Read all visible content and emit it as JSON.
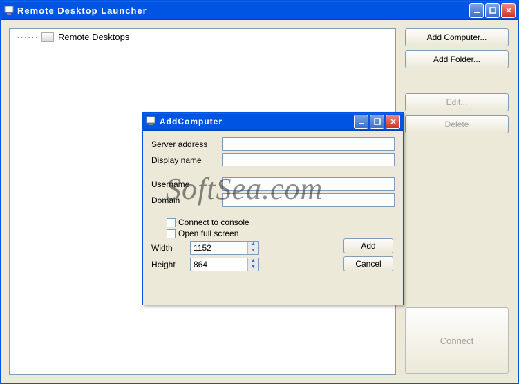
{
  "main_window": {
    "title": "Remote Desktop Launcher"
  },
  "tree": {
    "root_label": "Remote Desktops"
  },
  "sidebar": {
    "add_computer": "Add Computer...",
    "add_folder": "Add Folder...",
    "edit": "Edit...",
    "delete": "Delete",
    "connect": "Connect"
  },
  "dialog": {
    "title": "AddComputer",
    "labels": {
      "server_address": "Server address",
      "display_name": "Display name",
      "username": "Username",
      "domain": "Domain",
      "connect_console": "Connect to console",
      "open_fullscreen": "Open full screen",
      "width": "Width",
      "height": "Height"
    },
    "values": {
      "server_address": "",
      "display_name": "",
      "username": "",
      "domain": "",
      "connect_console": false,
      "open_fullscreen": false,
      "width": "1152",
      "height": "864"
    },
    "buttons": {
      "add": "Add",
      "cancel": "Cancel"
    }
  },
  "watermark": "SoftSea.com"
}
